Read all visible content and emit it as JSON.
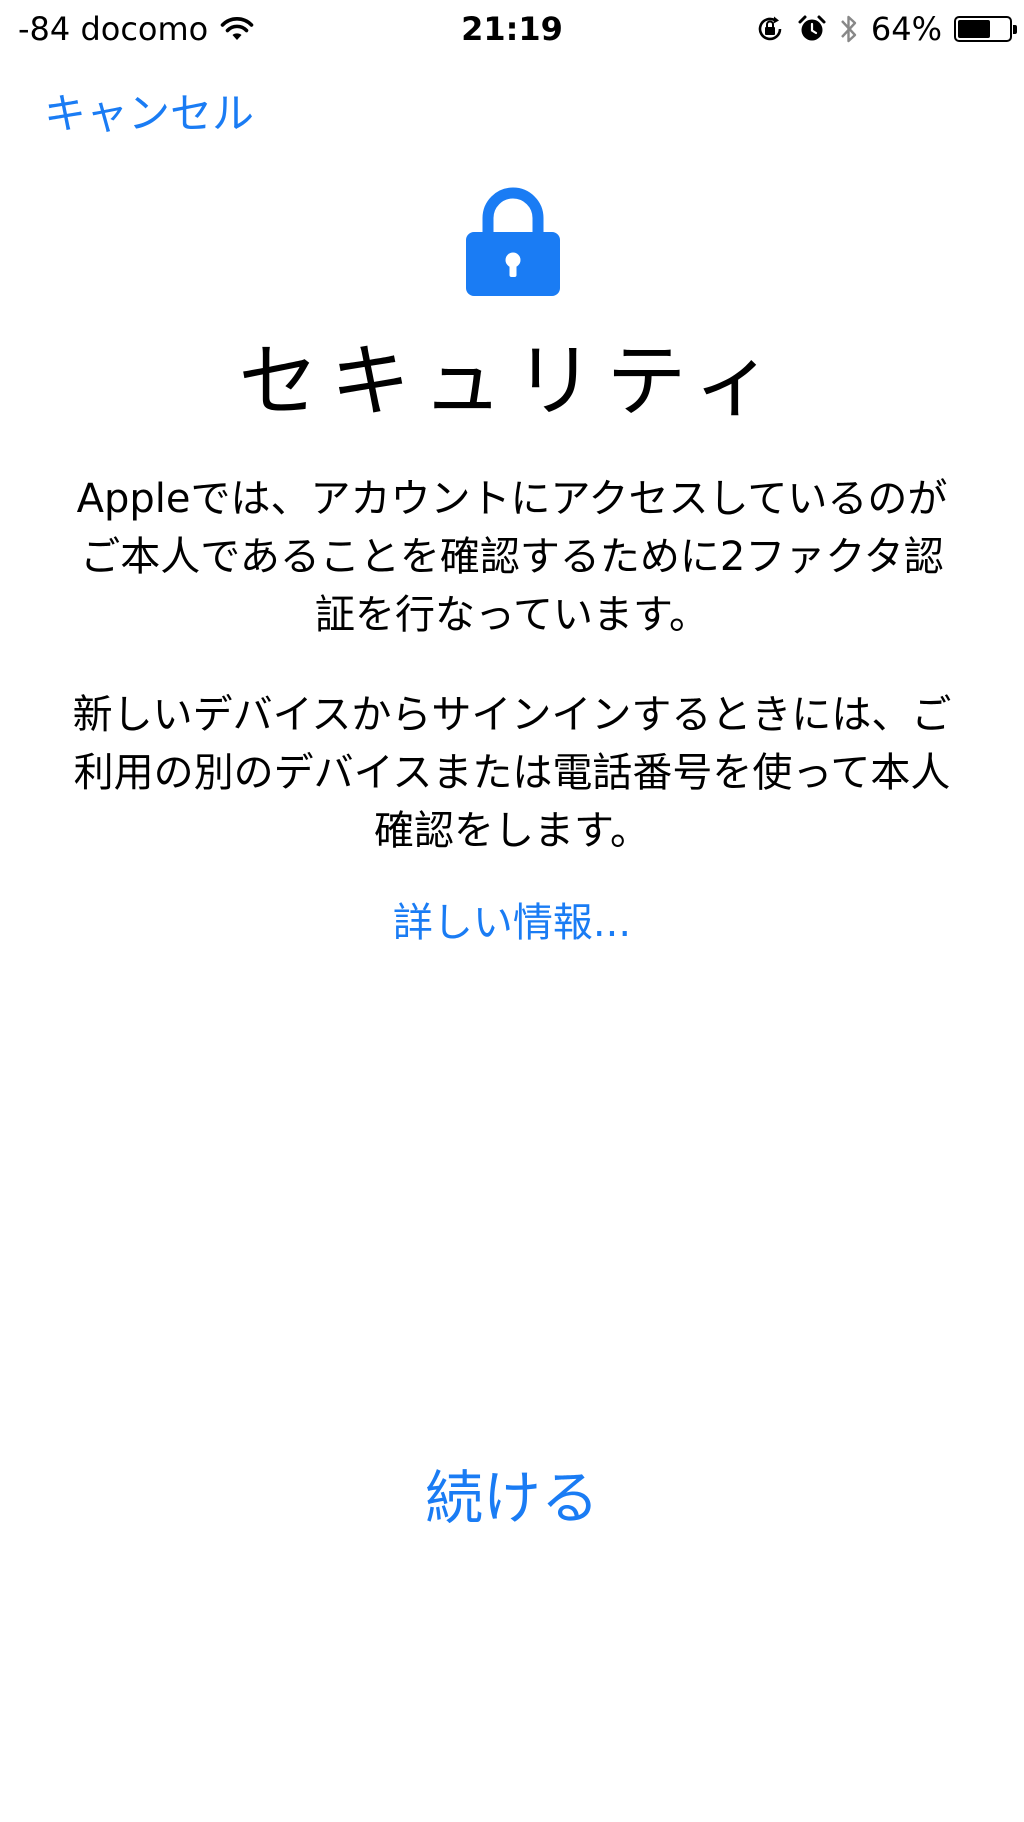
{
  "status_bar": {
    "carrier": "-84 docomo",
    "time": "21:19",
    "battery_percent": "64%",
    "battery_level": 0.64,
    "icons": [
      "wifi-icon",
      "orientation-lock-icon",
      "alarm-icon",
      "bluetooth-icon",
      "battery-icon"
    ]
  },
  "nav": {
    "cancel_label": "キャンセル"
  },
  "header": {
    "icon": "lock-icon",
    "title": "セキュリティ"
  },
  "body": {
    "paragraph1": "Appleでは、アカウントにアクセスしているのがご本人であることを確認するために2ファクタ認証を行なっています。",
    "paragraph2": "新しいデバイスからサインインするときには、ご利用の別のデバイスまたは電話番号を使って本人確認をします。",
    "more_info_link": "詳しい情報..."
  },
  "footer": {
    "continue_label": "続ける"
  },
  "colors": {
    "accent": "#1a7cf4",
    "text": "#000000",
    "background": "#ffffff"
  }
}
